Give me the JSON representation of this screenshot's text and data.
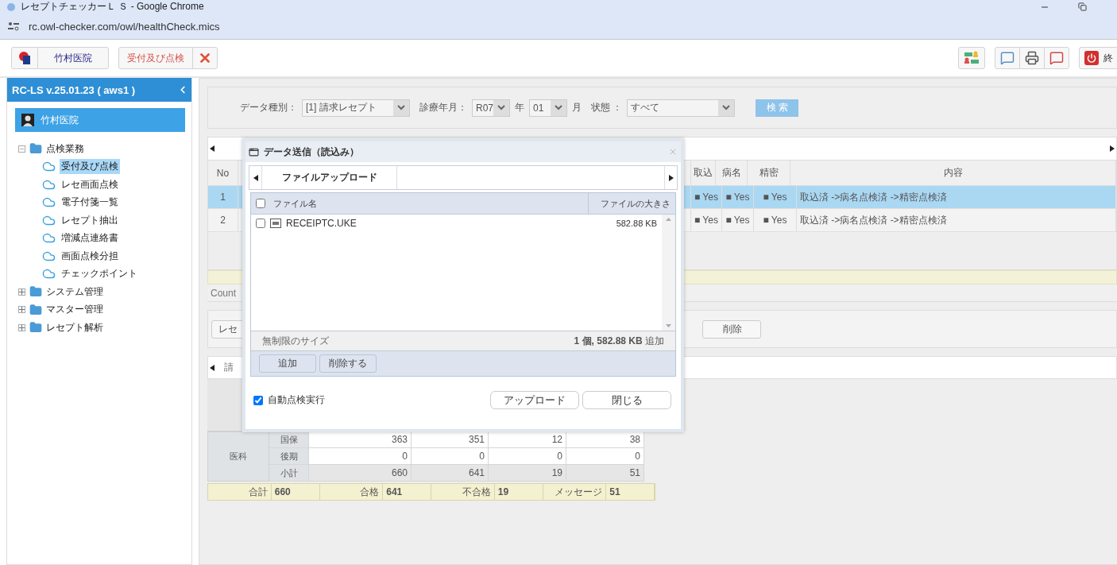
{
  "browser": {
    "title": "レセプトチェッカーＬ Ｓ - Google Chrome",
    "url": "rc.owl-checker.com/owl/healthCheck.mics"
  },
  "toolbar": {
    "clinic": "竹村医院",
    "open_tab": "受付及び点検",
    "exit": "終"
  },
  "sidebar": {
    "version": "RC-LS v.25.01.23 ( aws1 )",
    "user": "竹村医院",
    "tree": [
      {
        "label": "点検業務",
        "expanded": true,
        "children": [
          {
            "label": "受付及び点検",
            "selected": true
          },
          {
            "label": "レセ画面点検",
            "selected": false
          },
          {
            "label": "電子付箋一覧",
            "selected": false
          },
          {
            "label": "レセプト抽出",
            "selected": false
          },
          {
            "label": "増減点連絡書",
            "selected": false
          },
          {
            "label": "画面点検分担",
            "selected": false
          },
          {
            "label": "チェックポイント",
            "selected": false
          }
        ]
      },
      {
        "label": "システム管理",
        "expanded": false
      },
      {
        "label": "マスター管理",
        "expanded": false
      },
      {
        "label": "レセプト解析",
        "expanded": false
      }
    ]
  },
  "search": {
    "fields": [
      {
        "label": "データ種別：",
        "value": "[1] 請求レセプト"
      },
      {
        "label": "診療年月：",
        "value": "R07",
        "suffix": "年"
      },
      {
        "value": "01",
        "suffix": "月"
      },
      {
        "label": "状態 ：",
        "value": "すべて"
      }
    ],
    "button": "検 索"
  },
  "results": {
    "columns": [
      "No",
      "取込",
      "病名",
      "精密",
      "内容"
    ],
    "rows": [
      {
        "selected": true,
        "cells": [
          "1",
          "■ Yes",
          "■ Yes",
          "■ Yes",
          "取込済 ->病名点検済 ->精密点検済"
        ]
      },
      {
        "selected": false,
        "cells": [
          "2",
          "■ Yes",
          "■ Yes",
          "■ Yes",
          "取込済 ->病名点検済 ->精密点検済"
        ]
      }
    ]
  },
  "count_label": "Count",
  "actions": [
    "レセ",
    "削除"
  ],
  "lower_tab": "請",
  "summary": {
    "group": "医科",
    "rows": [
      {
        "label": "国保",
        "values": [
          "363",
          "351",
          "12",
          "38"
        ]
      },
      {
        "label": "後期",
        "values": [
          "0",
          "0",
          "0",
          "0"
        ]
      },
      {
        "label": "小計",
        "values": [
          "660",
          "641",
          "19",
          "51"
        ]
      }
    ],
    "totals": [
      {
        "label": "合計",
        "value": "660"
      },
      {
        "label": "合格",
        "value": "641"
      },
      {
        "label": "不合格",
        "value": "19"
      },
      {
        "label": "メッセージ",
        "value": "51"
      }
    ]
  },
  "dialog": {
    "title": "データ送信（読込み）",
    "tabs": [
      {
        "label": "ファイルアップロード",
        "selected": true
      }
    ],
    "columns": [
      "ファイル名",
      "ファイルの大きさ"
    ],
    "header_checked": false,
    "files": [
      {
        "name": "RECEIPTC.UKE",
        "size": "582.88 KB",
        "checked": false
      }
    ],
    "limit": "無制限のサイズ",
    "summary": "**1 個, 582.88 KB** 追加",
    "list_buttons": [
      "追加",
      "削除する"
    ],
    "auto_check": {
      "label": "自動点検実行",
      "checked": true
    },
    "buttons": [
      "アップロード",
      "閉じる"
    ]
  }
}
